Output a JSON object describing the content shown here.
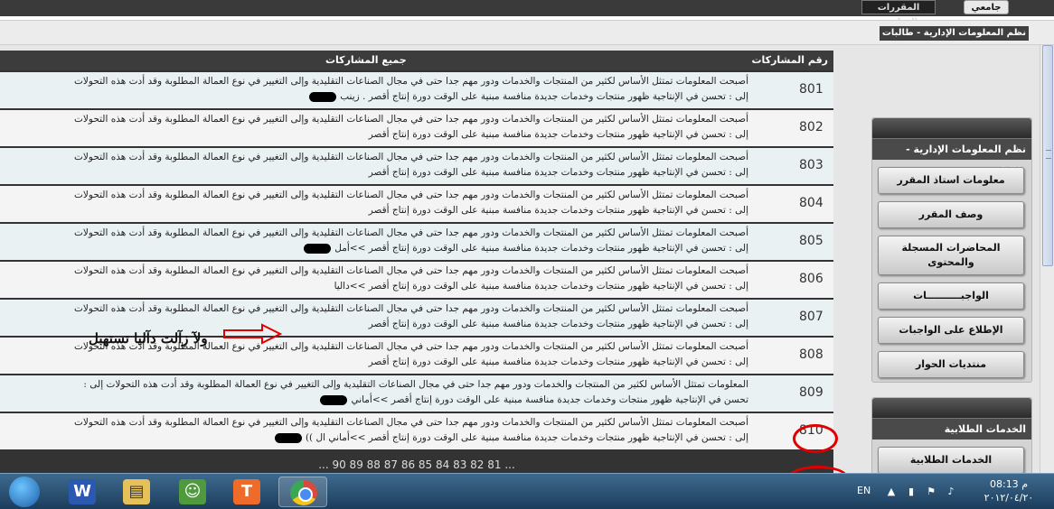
{
  "top_tabs": {
    "courses": "المقررات الدراسية",
    "university": "جامعي"
  },
  "breadcrumb": "نظم المعلومات الإدارية - طالبات",
  "table": {
    "header_num": "رقم المشاركات",
    "header_posts": "جميع المشاركات",
    "rows": [
      {
        "num": "801",
        "line1": "أصبحت المعلومات تمتثل الأساس لكثير من المنتجات والخدمات ودور مهم جدا حتى في مجال الصناعات التقليدية وإلى التغيير في نوع العمالة المطلوبة وقد أدت هذه التحولات",
        "line2": "إلى : تحسن في الإنتاجية ظهور منتجات وخدمات جديدة منافسة مبنية على الوقت دورة إنتاج أقصر . زينب"
      },
      {
        "num": "802",
        "line1": "أصبحت المعلومات تمتثل الأساس لكثير من المنتجات والخدمات ودور مهم جدا حتى في مجال الصناعات التقليدية وإلى التغيير في نوع العمالة المطلوبة وقد أدت هذه التحولات",
        "line2": "إلى : تحسن في الإنتاجية ظهور منتجات وخدمات جديدة منافسة مبنية على الوقت دورة إنتاج أقصر"
      },
      {
        "num": "803",
        "line1": "أصبحت المعلومات تمتثل الأساس لكثير من المنتجات والخدمات ودور مهم جدا حتى في مجال الصناعات التقليدية وإلى التغيير في نوع العمالة المطلوبة وقد أدت هذه التحولات",
        "line2": "إلى : تحسن في الإنتاجية ظهور منتجات وخدمات جديدة منافسة مبنية على الوقت دورة إنتاج أقصر"
      },
      {
        "num": "804",
        "line1": "أصبحت المعلومات تمتثل الأساس لكثير من المنتجات والخدمات ودور مهم جدا حتى في مجال الصناعات التقليدية وإلى التغيير في نوع العمالة المطلوبة وقد أدت هذه التحولات",
        "line2": "إلى : تحسن في الإنتاجية ظهور منتجات وخدمات جديدة منافسة مبنية على الوقت دورة إنتاج أقصر"
      },
      {
        "num": "805",
        "line1": "أصبحت المعلومات تمتثل الأساس لكثير من المنتجات والخدمات ودور مهم جدا حتى في مجال الصناعات التقليدية وإلى التغيير في نوع العمالة المطلوبة وقد أدت هذه التحولات",
        "line2": "إلى : تحسن في الإنتاجية ظهور منتجات وخدمات جديدة منافسة مبنية على الوقت دورة إنتاج أقصر >>أمل"
      },
      {
        "num": "806",
        "line1": "أصبحت المعلومات تمتثل الأساس لكثير من المنتجات والخدمات ودور مهم جدا حتى في مجال الصناعات التقليدية وإلى التغيير في نوع العمالة المطلوبة وقد أدت هذه التحولات",
        "line2": "إلى : تحسن في الإنتاجية ظهور منتجات وخدمات جديدة منافسة مبنية على الوقت دورة إنتاج أقصر >>داليا"
      },
      {
        "num": "807",
        "line1": "أصبحت المعلومات تمتثل الأساس لكثير من المنتجات والخدمات ودور مهم جدا حتى في مجال الصناعات التقليدية وإلى التغيير في نوع العمالة المطلوبة وقد أدت هذه التحولات",
        "line2": "إلى : تحسن في الإنتاجية ظهور منتجات وخدمات جديدة منافسة مبنية على الوقت دورة إنتاج أقصر"
      },
      {
        "num": "808",
        "line1": "أصبحت المعلومات تمتثل الأساس لكثير من المنتجات والخدمات ودور مهم جدا حتى في مجال الصناعات التقليدية وإلى التغيير في نوع العمالة المطلوبة وقد أدت هذه التحولات",
        "line2": "إلى : تحسن في الإنتاجية ظهور منتجات وخدمات جديدة منافسة مبنية على الوقت دورة إنتاج أقصر"
      },
      {
        "num": "809",
        "line1": "المعلومات تمتثل الأساس لكثير من المنتجات والخدمات ودور مهم جدا حتى في مجال الصناعات التقليدية وإلى التغيير في نوع العمالة المطلوبة وقد أدت هذه التحولات إلى :",
        "line2": "تحسن في الإنتاجية ظهور منتجات وخدمات جديدة منافسة مبنية على الوقت دورة إنتاج أقصر >>أماني"
      },
      {
        "num": "810",
        "line1": "أصبحت المعلومات تمتثل الأساس لكثير من المنتجات والخدمات ودور مهم جدا حتى في مجال الصناعات التقليدية وإلى التغيير في نوع العمالة المطلوبة وقد أدت هذه التحولات",
        "line2": "إلى : تحسن في الإنتاجية ظهور منتجات وخدمات جديدة منافسة مبنية على الوقت دورة إنتاج أقصر >>أماني ال ))"
      }
    ],
    "pager": "... 90 89 88 87 86 85 84 83 82 81 ..."
  },
  "annotation": {
    "text": "ولآ زآلت دآليا تستهبل",
    "color": "#e00000"
  },
  "sidebar": {
    "course_panel_title": "نظم المعلومات الإدارية - طالبات",
    "course_buttons": [
      "معلومات استاذ المقرر",
      "وصف المقرر",
      "المحاضرات المسجلة والمحتوى",
      "الواجبــــــــــات",
      "الإطلاع على الواجبات",
      "منتديات الحوار"
    ],
    "services_panel_title": "الخدمات الطلابية",
    "services_button": "الخدمات الطلابية"
  },
  "taskbar": {
    "icons": [
      "start-orb-icon",
      "word-icon",
      "file-explorer-icon",
      "messenger-icon",
      "app-t-icon",
      "chrome-icon"
    ],
    "app_t_glyph": "T",
    "lang": "EN",
    "clock_time": "08:13 م",
    "clock_date": "٢٠١٢/٠٤/٢٠"
  }
}
